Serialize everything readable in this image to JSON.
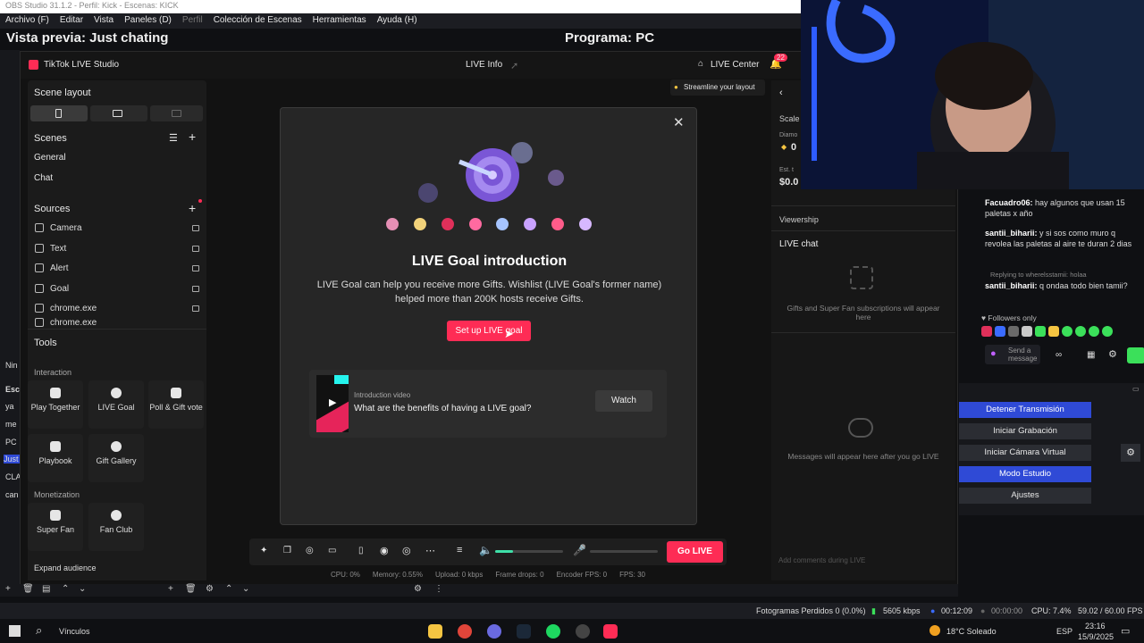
{
  "obs": {
    "window_title": "OBS Studio 31.1.2 - Perfil: Kick - Escenas: KICK",
    "menu": [
      "Archivo (F)",
      "Editar",
      "Vista",
      "Paneles (D)",
      "Perfil",
      "Colección de Escenas",
      "Herramientas",
      "Ayuda (H)"
    ],
    "preview_title": "Vista previa: Just chating",
    "program_title": "Programa: PC",
    "left_fragments": [
      "Nin",
      "Esc",
      "ya",
      "me",
      "PC",
      "Just",
      "CLA",
      "can"
    ],
    "controls": [
      "Detener Transmisión",
      "Iniciar Grabación",
      "Iniciar Cámara Virtual",
      "Modo Estudio",
      "Ajustes"
    ],
    "status": {
      "dropped": "Fotogramas Perdidos 0 (0.0%)",
      "bitrate": "5605 kbps",
      "live_time": "00:12:09",
      "rec_time": "00:00:00",
      "cpu": "CPU: 7.4%",
      "fps": "59.02 / 60.00 FPS"
    }
  },
  "tiktok": {
    "app_name": "TikTok LIVE Studio",
    "header": {
      "center": "LIVE Info",
      "live_center": "LIVE Center",
      "badge": "22"
    },
    "streamline": "Streamline your layout",
    "left": {
      "scene_layout": "Scene layout",
      "scenes_title": "Scenes",
      "scenes": [
        "General",
        "Chat"
      ],
      "sources_title": "Sources",
      "sources": [
        "Camera",
        "Text",
        "Alert",
        "Goal",
        "chrome.exe",
        "chrome.exe"
      ],
      "tools_title": "Tools",
      "interaction": "Interaction",
      "tools_interaction": [
        "Play Together",
        "LIVE Goal",
        "Poll & Gift vote",
        "Playbook",
        "Gift Gallery"
      ],
      "monetization": "Monetization",
      "tools_monetization": [
        "Super Fan",
        "Fan Club"
      ],
      "expand": "Expand audience"
    },
    "modal": {
      "title": "LIVE Goal introduction",
      "description": "LIVE Goal can help you receive more Gifts. Wishlist (LIVE Goal's former name) helped more than 200K hosts receive Gifts.",
      "button": "Set up LIVE goal",
      "video_label": "Introduction video",
      "video_question": "What are the benefits of having a LIVE goal?",
      "watch": "Watch"
    },
    "right": {
      "scale": "Scale",
      "diamonds": "Diamo",
      "diamond_val": "0",
      "est": "Est. t",
      "est_val": "$0.0",
      "viewership": "Viewership",
      "live_chat": "LIVE chat",
      "gifts_note": "Gifts and Super Fan subscriptions will appear here",
      "messages_note": "Messages will appear here after you go LIVE",
      "comment_placeholder": "Add comments during LIVE"
    },
    "go_live": "Go LIVE",
    "perf": {
      "cpu": "CPU:  0%",
      "memory": "Memory:  0.55%",
      "upload": "Upload:  0 kbps",
      "frame_drops": "Frame drops:  0",
      "encoder_fps": "Encoder FPS:  0",
      "fps": "FPS:  30"
    }
  },
  "chat": [
    {
      "user": "Facuadro06:",
      "text": "hay algunos que usan 15 paletas x año"
    },
    {
      "user": "santii_biharii:",
      "text": "y si sos como muro q revolea las paletas al aire te duran 2 dias"
    },
    {
      "reply": "Replying to wherelsstamii: holaa"
    },
    {
      "user": "santii_biharii:",
      "text": "q ondaa todo bien tamii?"
    }
  ],
  "followers_only": "Followers only",
  "chat_input_placeholder": "Send a message",
  "taskbar": {
    "search": "Vínculos",
    "weather": "18°C  Soleado",
    "lang": "ESP",
    "time": "23:16",
    "date": "15/9/2025"
  },
  "colors": {
    "tiktok_pink": "#fe2c55",
    "obs_blue": "#2f4ad6",
    "goal_purple": "#7a56d6"
  }
}
